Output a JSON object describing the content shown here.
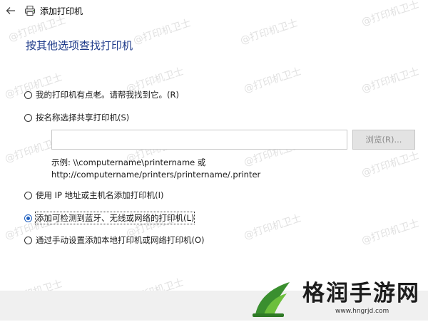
{
  "window": {
    "title": "添加打印机"
  },
  "heading": "按其他选项查找打印机",
  "options": [
    {
      "label": "我的打印机有点老。请帮我找到它。(R)",
      "checked": false
    },
    {
      "label": "按名称选择共享打印机(S)",
      "checked": false
    },
    {
      "label": "使用 IP 地址或主机名添加打印机(I)",
      "checked": false
    },
    {
      "label": "添加可检测到蓝牙、无线或网络的打印机(L)",
      "checked": true
    },
    {
      "label": "通过手动设置添加本地打印机或网络打印机(O)",
      "checked": false
    }
  ],
  "share": {
    "value": "",
    "browse_label": "浏览(R)...",
    "example_line1": "示例: \\\\computername\\printername 或",
    "example_line2": "http://computername/printers/printername/.printer"
  },
  "watermark": "@打印机卫士",
  "brand": {
    "name": "格润手游网",
    "url": "www.hngrjd.com"
  },
  "colors": {
    "heading": "#1e3a8a",
    "radio_checked": "#1e5fbf",
    "brand_green": "#3a8f2f"
  },
  "icons": {
    "back": "back-arrow-icon",
    "printer": "printer-icon",
    "brand": "grass-sprout-logo"
  }
}
